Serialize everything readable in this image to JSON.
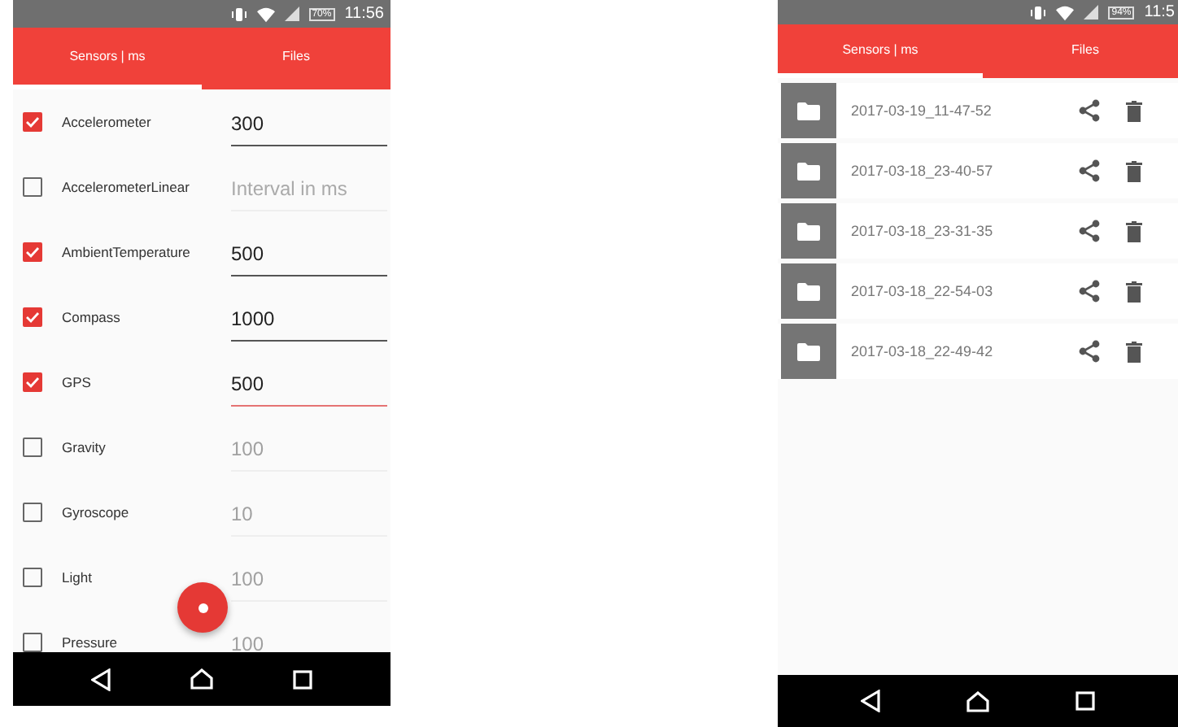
{
  "screens": [
    {
      "status_bar": {
        "battery": "70%",
        "time": "11:56"
      },
      "tabs": [
        {
          "label": "Sensors | ms",
          "selected": true
        },
        {
          "label": "Files",
          "selected": false
        }
      ],
      "kind": "sensors",
      "sensors": [
        {
          "name": "Accelerometer",
          "checked": true,
          "value": "300",
          "focused": false
        },
        {
          "name": "AccelerometerLinear",
          "checked": false,
          "placeholder": "Interval in ms",
          "focused": false
        },
        {
          "name": "AmbientTemperature",
          "checked": true,
          "value": "500",
          "focused": false
        },
        {
          "name": "Compass",
          "checked": true,
          "value": "1000",
          "focused": false
        },
        {
          "name": "GPS",
          "checked": true,
          "value": "500",
          "focused": true
        },
        {
          "name": "Gravity",
          "checked": false,
          "value": "100",
          "focused": false
        },
        {
          "name": "Gyroscope",
          "checked": false,
          "value": "10",
          "focused": false
        },
        {
          "name": "Light",
          "checked": false,
          "value": "100",
          "focused": false
        },
        {
          "name": "Pressure",
          "checked": false,
          "value": "100",
          "focused": false
        }
      ]
    },
    {
      "status_bar": {
        "battery": "94%",
        "time": "11:5"
      },
      "tabs": [
        {
          "label": "Sensors | ms",
          "selected": true
        },
        {
          "label": "Files",
          "selected": false
        }
      ],
      "kind": "files",
      "files": [
        {
          "name": "2017-03-19_11-47-52"
        },
        {
          "name": "2017-03-18_23-40-57"
        },
        {
          "name": "2017-03-18_23-31-35"
        },
        {
          "name": "2017-03-18_22-54-03"
        },
        {
          "name": "2017-03-18_22-49-42"
        }
      ]
    }
  ]
}
